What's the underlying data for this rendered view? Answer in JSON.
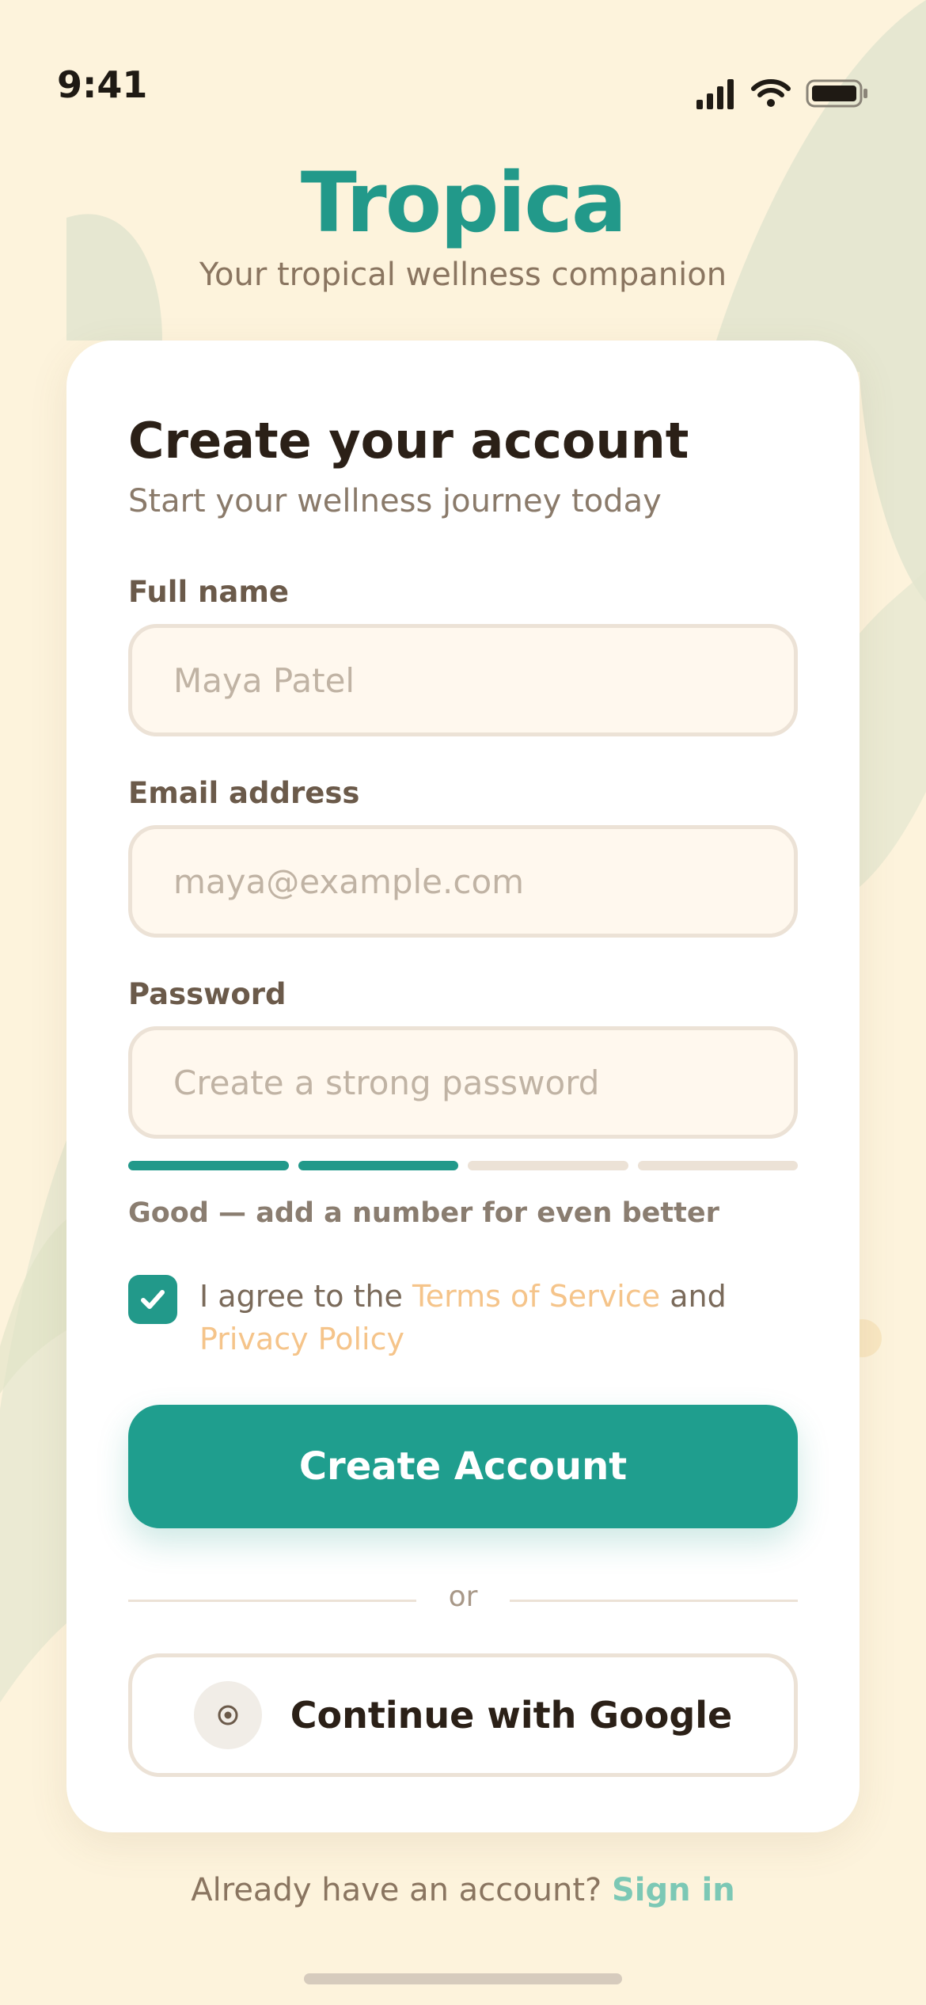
{
  "status_bar": {
    "time": "9:41"
  },
  "brand": {
    "title": "Tropica",
    "tagline": "Your tropical wellness companion"
  },
  "form": {
    "title": "Create your account",
    "subtitle": "Start your wellness journey today",
    "fields": {
      "full_name": {
        "label": "Full name",
        "placeholder": "Maya Patel",
        "value": ""
      },
      "email": {
        "label": "Email address",
        "placeholder": "maya@example.com",
        "value": ""
      },
      "password": {
        "label": "Password",
        "placeholder": "Create a strong password",
        "value": ""
      }
    },
    "password_strength": {
      "filled_segments": 2,
      "total_segments": 4,
      "message": "Good — add a number for even better"
    },
    "agreement": {
      "checked": true,
      "prefix": "I agree to the ",
      "terms_link": "Terms of Service",
      "middle": " and ",
      "privacy_link": "Privacy Policy"
    },
    "submit_label": "Create Account",
    "divider_text": "or",
    "google_label": "Continue with Google"
  },
  "footer": {
    "prompt": "Already have an account?",
    "signin_label": "Sign in"
  },
  "colors": {
    "accent": "#22998a",
    "background": "#fdf3dc",
    "link": "#f5c48a",
    "signin": "#7cc8b5"
  }
}
